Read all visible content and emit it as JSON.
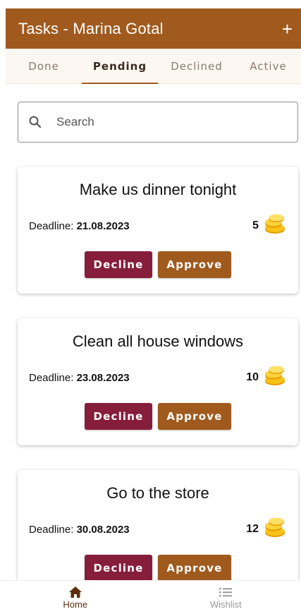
{
  "appbar": {
    "title": "Tasks - Marina Gotal",
    "add_label": "+"
  },
  "tabs": [
    {
      "label": "Done"
    },
    {
      "label": "Pending"
    },
    {
      "label": "Declined"
    },
    {
      "label": "Active"
    }
  ],
  "active_tab": "Pending",
  "search": {
    "placeholder": "Search",
    "value": ""
  },
  "tasks": [
    {
      "title": "Make us dinner tonight",
      "deadline_label": "Deadline:",
      "deadline": "21.08.2023",
      "reward": "5",
      "decline_label": "Decline",
      "approve_label": "Approve"
    },
    {
      "title": "Clean all house windows",
      "deadline_label": "Deadline:",
      "deadline": "23.08.2023",
      "reward": "10",
      "decline_label": "Decline",
      "approve_label": "Approve"
    },
    {
      "title": "Go to the store",
      "deadline_label": "Deadline:",
      "deadline": "30.08.2023",
      "reward": "12",
      "decline_label": "Decline",
      "approve_label": "Approve"
    }
  ],
  "bottom_nav": [
    {
      "label": "Home",
      "icon": "home-icon"
    },
    {
      "label": "Wishlist",
      "icon": "list-icon"
    }
  ],
  "colors": {
    "primary": "#a05a1e",
    "decline": "#861d3a",
    "tab_bg": "#fdf7f1"
  }
}
